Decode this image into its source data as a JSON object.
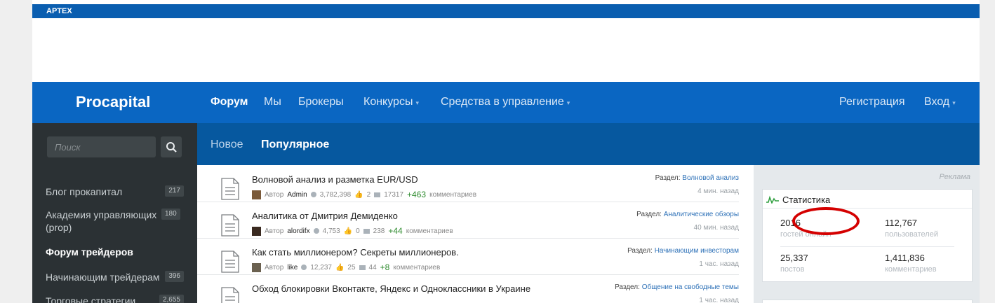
{
  "topbar": {
    "label": "APTEX"
  },
  "header": {
    "logo": "Procapital",
    "nav": [
      {
        "label": "Форум",
        "active": true
      },
      {
        "label": "Мы"
      },
      {
        "label": "Брокеры"
      },
      {
        "label": "Конкурсы"
      },
      {
        "label": "Средства в управление"
      }
    ],
    "register": "Регистрация",
    "login": "Вход"
  },
  "sidebar": {
    "search_placeholder": "Поиск",
    "items": [
      {
        "label": "Блог прокапитал",
        "count": "217"
      },
      {
        "label": "Академия управляющих (prop)",
        "count": "180"
      },
      {
        "label": "Форум трейдеров"
      },
      {
        "label": "Начинающим трейдерам",
        "count": "396"
      },
      {
        "label": "Торговые стратегии",
        "count": "2,655"
      }
    ]
  },
  "subnav": {
    "tabs": [
      {
        "label": "Новое"
      },
      {
        "label": "Популярное",
        "active": true
      }
    ]
  },
  "threads": [
    {
      "title": "Волновой анализ и разметка EUR/USD",
      "author_label": "Автор",
      "author": "Admin",
      "views": "3,782,398",
      "likes": "2",
      "comments": "17317",
      "new": "+463",
      "comments_label": "комментариев",
      "section_label": "Раздел:",
      "section": "Волновой анализ",
      "time": "4 мин. назад"
    },
    {
      "title": "Аналитика от Дмитрия Демиденко",
      "author_label": "Автор",
      "author": "alordifx",
      "views": "4,753",
      "likes": "0",
      "comments": "238",
      "new": "+44",
      "comments_label": "комментариев",
      "section_label": "Раздел:",
      "section": "Аналитические обзоры",
      "time": "40 мин. назад"
    },
    {
      "title": "Как стать миллионером? Секреты миллионеров.",
      "author_label": "Автор",
      "author": "like",
      "views": "12,237",
      "likes": "25",
      "comments": "44",
      "new": "+8",
      "comments_label": "комментариев",
      "section_label": "Раздел:",
      "section": "Начинающим инвесторам",
      "time": "1 час. назад"
    },
    {
      "title": "Обход блокировки Вконтакте, Яндекс и Одноклассники в Украине",
      "section_label": "Раздел:",
      "section": "Общение на свободные темы",
      "time": "1 час. назад"
    }
  ],
  "right": {
    "ad": "Реклама",
    "stats_title": "Статистика",
    "stats": [
      {
        "value": "2016",
        "label": "гостей онлайн"
      },
      {
        "value": "112,767",
        "label": "пользователей"
      },
      {
        "value": "25,337",
        "label": "постов"
      },
      {
        "value": "1,411,836",
        "label": "комментариев"
      }
    ]
  },
  "colors": {
    "brand": "#0a66c2",
    "subnav": "#06589f",
    "sidebar": "#2b3134",
    "highlight_circle": "#d40000"
  }
}
